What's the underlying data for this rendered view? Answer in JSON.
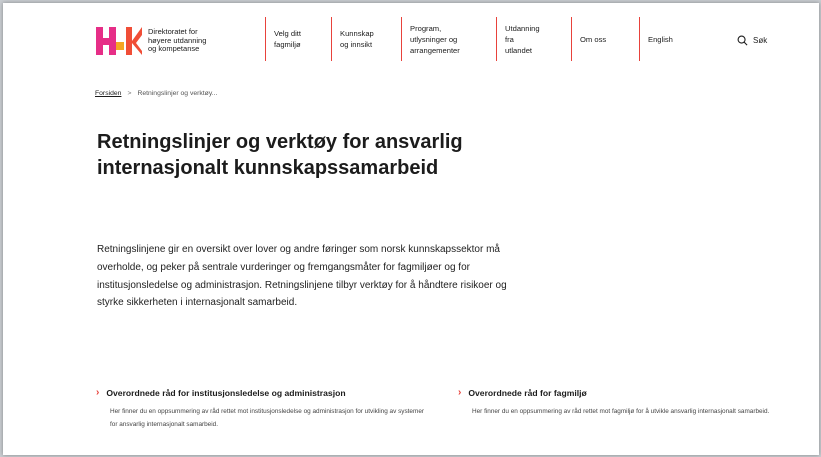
{
  "colors": {
    "accent": "#e8423b",
    "logo_pink": "#e62e87",
    "logo_red": "#f04e37"
  },
  "logo": {
    "line1": "Direktoratet for",
    "line2": "høyere utdanning",
    "line3": "og kompetanse"
  },
  "nav": [
    {
      "line1": "Velg ditt",
      "line2": "fagmiljø",
      "line3": "",
      "line4": ""
    },
    {
      "line1": "Kunnskap",
      "line2": "og innsikt",
      "line3": "",
      "line4": ""
    },
    {
      "line1": "Program,",
      "line2": "utlysninger og",
      "line3": "arrangementer",
      "line4": ""
    },
    {
      "line1": "Utdanning",
      "line2": "fra",
      "line3": "utlandet",
      "line4": ""
    },
    {
      "line1": "Om oss",
      "line2": "",
      "line3": "",
      "line4": ""
    },
    {
      "line1": "English",
      "line2": "",
      "line3": "",
      "line4": ""
    }
  ],
  "search": {
    "label": "Søk",
    "icon": "search-icon"
  },
  "breadcrumb": {
    "home": "Forsiden",
    "separator": ">",
    "current": "Retningslinjer og verktøy..."
  },
  "page": {
    "title": "Retningslinjer og verktøy for ansvarlig internasjonalt kunnskapssamarbeid",
    "intro": "Retningslinjene gir en oversikt over lover og andre føringer som norsk kunnskapssektor må overholde, og peker på sentrale vurderinger og fremgangsmåter for fagmiljøer og for institusjonsledelse og administrasjon. Retningslinjene tilbyr verktøy for å håndtere risikoer og styrke sikkerheten i internasjonalt samarbeid."
  },
  "cards": [
    {
      "title": "Overordnede råd for institusjonsledelse og administrasjon",
      "description": "Her finner du en oppsummering av råd rettet mot institusjonsledelse og administrasjon for utvikling av systemer for ansvarlig internasjonalt samarbeid."
    },
    {
      "title": "Overordnede råd for fagmiljø",
      "description": "Her finner du en oppsummering av råd rettet mot fagmiljø for å utvikle ansvarlig internasjonalt samarbeid."
    }
  ]
}
